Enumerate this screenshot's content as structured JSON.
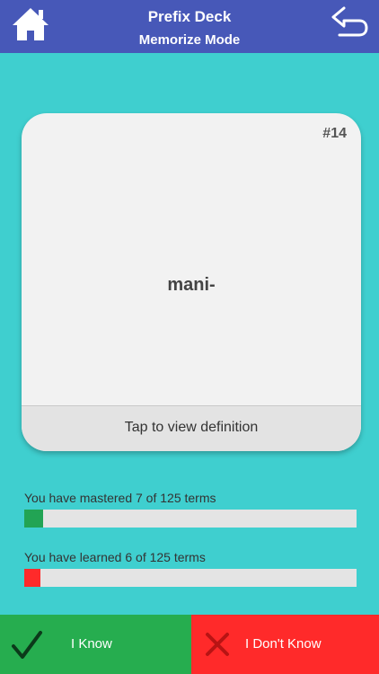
{
  "header": {
    "title": "Prefix Deck",
    "subtitle": "Memorize Mode",
    "home_icon": "home-icon",
    "back_icon": "back-arrow-icon"
  },
  "card": {
    "number": "#14",
    "term": "mani-",
    "footer_label": "Tap to view definition"
  },
  "progress": {
    "mastered": {
      "label": "You have mastered 7 of 125 terms",
      "value": 7,
      "total": 125,
      "color": "#22a454"
    },
    "learned": {
      "label": "You have learned 6 of 125 terms",
      "value": 6,
      "total": 125,
      "color": "#ff2a2a"
    }
  },
  "actions": {
    "know_label": "I Know",
    "know_icon": "checkmark-icon",
    "dont_know_label": "I Don't Know",
    "dont_know_icon": "x-icon"
  },
  "colors": {
    "background": "#3fcfcf",
    "header": "#4758b8",
    "know": "#26ad4f",
    "dont_know": "#ff2a2a"
  }
}
